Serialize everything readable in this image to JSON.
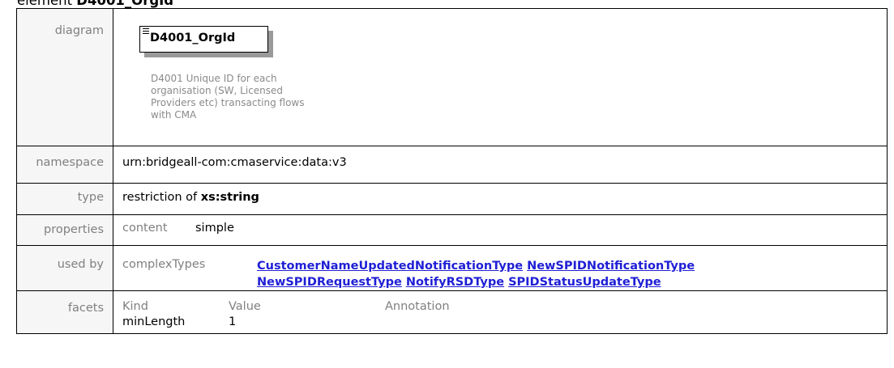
{
  "heading": {
    "prefix": "element",
    "name": "D4001_OrgId"
  },
  "rows": {
    "diagram": {
      "label": "diagram",
      "element_name": "D4001_OrgId",
      "description": "D4001 Unique ID for each organisation (SW, Licensed Providers etc) transacting flows with CMA"
    },
    "namespace": {
      "label": "namespace",
      "value": "urn:bridgeall-com:cmaservice:data:v3"
    },
    "type": {
      "label": "type",
      "prefix": "restriction of",
      "base": "xs:string"
    },
    "properties": {
      "label": "properties",
      "key": "content",
      "value": "simple"
    },
    "used_by": {
      "label": "used by",
      "key": "complexTypes",
      "links": [
        "CustomerNameUpdatedNotificationType",
        "NewSPIDNotificationType",
        "NewSPIDRequestType",
        "NotifyRSDType",
        "SPIDStatusUpdateType"
      ]
    },
    "facets": {
      "label": "facets",
      "headers": [
        "Kind",
        "Value",
        "Annotation"
      ],
      "row": [
        "minLength",
        "1",
        ""
      ]
    }
  }
}
